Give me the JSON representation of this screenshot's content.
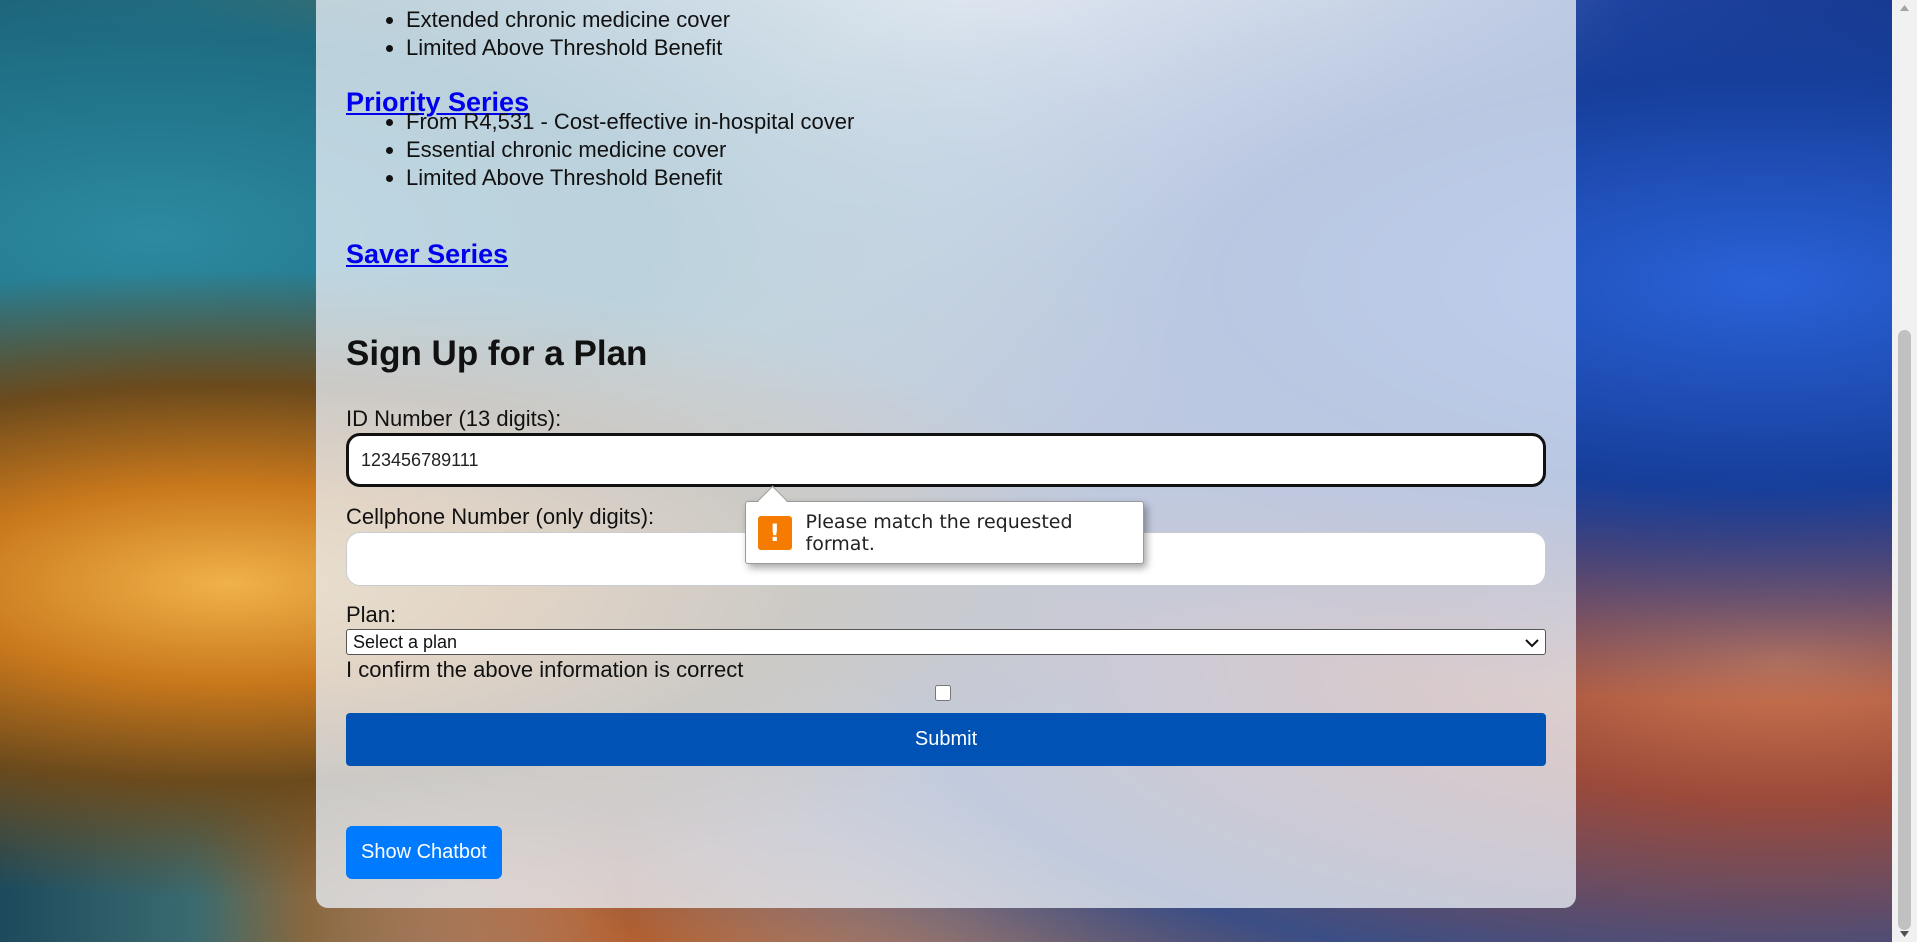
{
  "plans": [
    {
      "features": [
        "Extended chronic medicine cover",
        "Limited Above Threshold Benefit"
      ]
    },
    {
      "name": "Priority Series",
      "features": [
        "From R4,531 - Cost-effective in-hospital cover",
        "Essential chronic medicine cover",
        "Limited Above Threshold Benefit"
      ]
    },
    {
      "name": "Saver Series"
    }
  ],
  "form": {
    "title": "Sign Up for a Plan",
    "id_label": "ID Number (13 digits):",
    "id_value": "123456789111",
    "cell_label": "Cellphone Number (only digits):",
    "cell_value": "",
    "plan_label": "Plan:",
    "plan_selected": "Select a plan",
    "confirm_label": "I confirm the above information is correct",
    "confirm_checked": false,
    "submit_label": "Submit"
  },
  "validation_tooltip": {
    "message": "Please match the requested format.",
    "icon": "warning-icon",
    "icon_color": "#f57c00"
  },
  "chatbot": {
    "button_label": "Show Chatbot"
  },
  "colors": {
    "submit": "#0052b4",
    "chatbot": "#007bff",
    "link": "#0000ee"
  }
}
